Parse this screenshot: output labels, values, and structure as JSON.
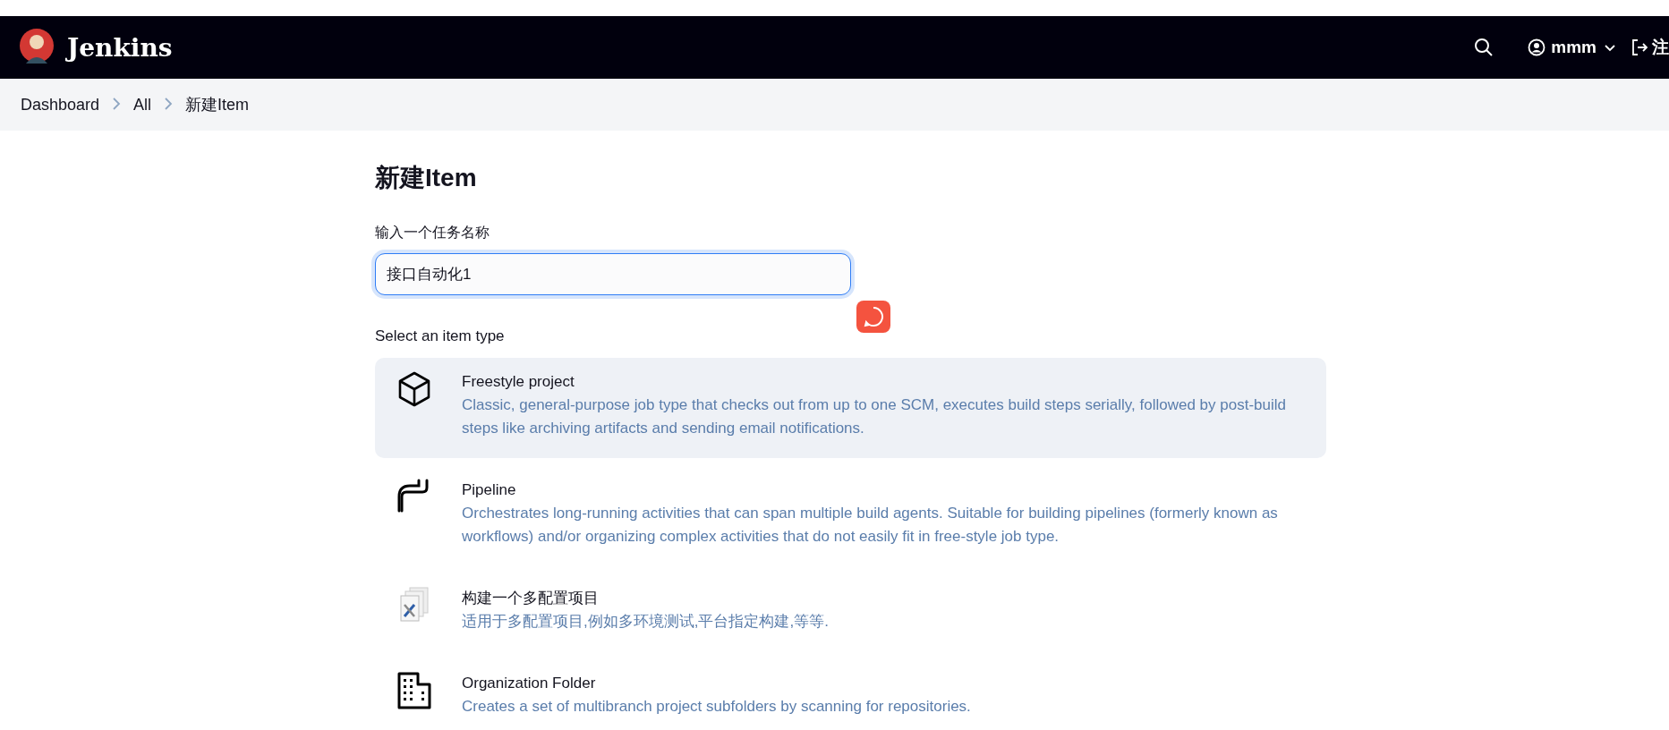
{
  "header": {
    "brand": "Jenkins",
    "user": "mmm",
    "logout": "注"
  },
  "breadcrumbs": [
    "Dashboard",
    "All",
    "新建Item"
  ],
  "page": {
    "title": "新建Item",
    "name_label": "输入一个任务名称",
    "name_value": "接口自动化1",
    "type_label": "Select an item type"
  },
  "item_types": [
    {
      "kind": "freestyle",
      "selected": true,
      "name": "Freestyle project",
      "description": "Classic, general-purpose job type that checks out from up to one SCM, executes build steps serially, followed by post-build steps like archiving artifacts and sending email notifications."
    },
    {
      "kind": "pipeline",
      "selected": false,
      "name": "Pipeline",
      "description": "Orchestrates long-running activities that can span multiple build agents. Suitable for building pipelines (formerly known as workflows) and/or organizing complex activities that do not easily fit in free-style job type."
    },
    {
      "kind": "matrix",
      "selected": false,
      "name": "构建一个多配置项目",
      "description": "适用于多配置项目,例如多环境测试,平台指定构建,等等."
    },
    {
      "kind": "folder",
      "selected": false,
      "name": "Organization Folder",
      "description": "Creates a set of multibranch project subfolders by scanning for repositories."
    }
  ]
}
